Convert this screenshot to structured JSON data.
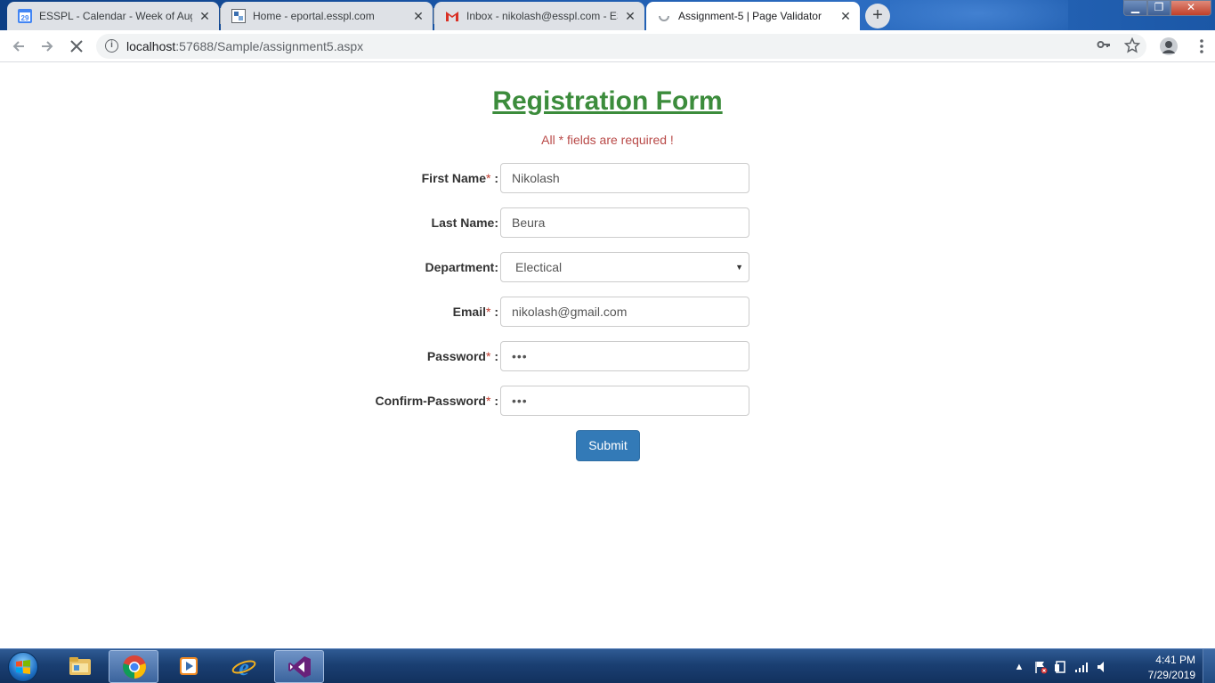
{
  "browser": {
    "tabs": [
      {
        "title": "ESSPL - Calendar - Week of Augu",
        "favicon": "calendar-icon",
        "active": false
      },
      {
        "title": "Home - eportal.esspl.com",
        "favicon": "site-icon",
        "active": false
      },
      {
        "title": "Inbox - nikolash@esspl.com - ESS",
        "favicon": "gmail-icon",
        "active": false
      },
      {
        "title": "Assignment-5 | Page Validator",
        "favicon": "loading-spinner-icon",
        "active": true
      }
    ],
    "calendar_favicon_text": "29",
    "close_glyph": "✕",
    "new_tab_glyph": "+",
    "window_controls": {
      "minimize": "▁",
      "maximize": "❐",
      "close": "✕"
    },
    "url_host": "localhost",
    "url_rest": ":57688/Sample/assignment5.aspx"
  },
  "form": {
    "title": "Registration Form",
    "required_note": "All * fields are required !",
    "fields": [
      {
        "label": "First Name",
        "required": true,
        "suffix": " :",
        "value": "Nikolash",
        "type": "text"
      },
      {
        "label": "Last Name:",
        "required": false,
        "suffix": "",
        "value": "Beura",
        "type": "text"
      },
      {
        "label": "Department:",
        "required": false,
        "suffix": "",
        "value": "Electical",
        "type": "select"
      },
      {
        "label": "Email",
        "required": true,
        "suffix": " :",
        "value": "nikolash@gmail.com",
        "type": "text"
      },
      {
        "label": "Password",
        "required": true,
        "suffix": " :",
        "value": "•••",
        "type": "password"
      },
      {
        "label": "Confirm-Password",
        "required": true,
        "suffix": " :",
        "value": "•••",
        "type": "password"
      }
    ],
    "required_marker": "*",
    "submit_label": "Submit"
  },
  "taskbar": {
    "apps": [
      {
        "name": "file-explorer-icon",
        "active": false
      },
      {
        "name": "chrome-icon",
        "active": true
      },
      {
        "name": "media-player-icon",
        "active": false
      },
      {
        "name": "internet-explorer-icon",
        "active": false
      },
      {
        "name": "visual-studio-icon",
        "active": false
      }
    ],
    "clock_time": "4:41 PM",
    "clock_date": "7/29/2019"
  },
  "colors": {
    "title_green": "#3c8c3c",
    "note_red": "#b94a48",
    "button_blue": "#337ab7"
  }
}
